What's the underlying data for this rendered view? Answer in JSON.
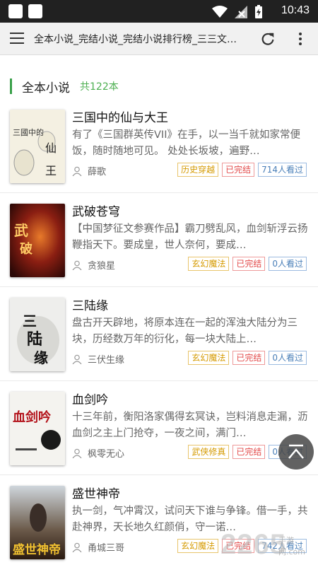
{
  "status_bar": {
    "time": "10:43"
  },
  "toolbar": {
    "title": "全本小说_完结小说_完结小说排行榜_三三文…"
  },
  "section": {
    "title": "全本小说",
    "count": "共122本"
  },
  "books": [
    {
      "title": "三国中的仙与大王",
      "desc": "有了《三国群英传VII》在手，以一当千就如家常便饭，随时随地可见。 处处长坂坡，遍野…",
      "author": "薛歌",
      "tags": [
        "历史穿越",
        "已完结",
        "714人看过"
      ],
      "cover_text": "三国中的仙与大王"
    },
    {
      "title": "武破苍穹",
      "desc": "【中国梦征文参赛作品】霸刀劈乱风，血剑斩浮云扬鞭指天下。要成皇，世人奈何，要成…",
      "author": "贪狼星",
      "tags": [
        "玄幻魔法",
        "已完结",
        "0人看过"
      ],
      "cover_text": "武破苍穹"
    },
    {
      "title": "三陆缘",
      "desc": "盘古开天辟地，将原本连在一起的浑浊大陆分为三块，历经数万年的衍化，每一块大陆上…",
      "author": "三伏生缘",
      "tags": [
        "玄幻魔法",
        "已完结",
        "0人看过"
      ],
      "cover_text": "三陆缘"
    },
    {
      "title": "血剑吟",
      "desc": "十三年前，衡阳洛家偶得玄冥诀，岂料消息走漏，沥血剑之主上门抢夺，一夜之间，满门…",
      "author": "枫零无心",
      "tags": [
        "武侠修真",
        "已完结",
        "0人看过"
      ],
      "cover_text": "血剑吟"
    },
    {
      "title": "盛世神帝",
      "desc": "执一剑，气冲霄汉，试问天下谁与争锋。借一手，共赴神界，天长地久红颜俏，守一诺…",
      "author": "甬城三哥",
      "tags": [
        "玄幻魔法",
        "已完结",
        "742人看过"
      ],
      "cover_text": "盛世神帝"
    }
  ],
  "watermark": {
    "logo": "2265",
    "sub": "手游网",
    "sub_en": ".com"
  },
  "colors": {
    "accent": "#3aa04a",
    "status_bar": "#212121",
    "toolbar": "#f1f1f1"
  }
}
